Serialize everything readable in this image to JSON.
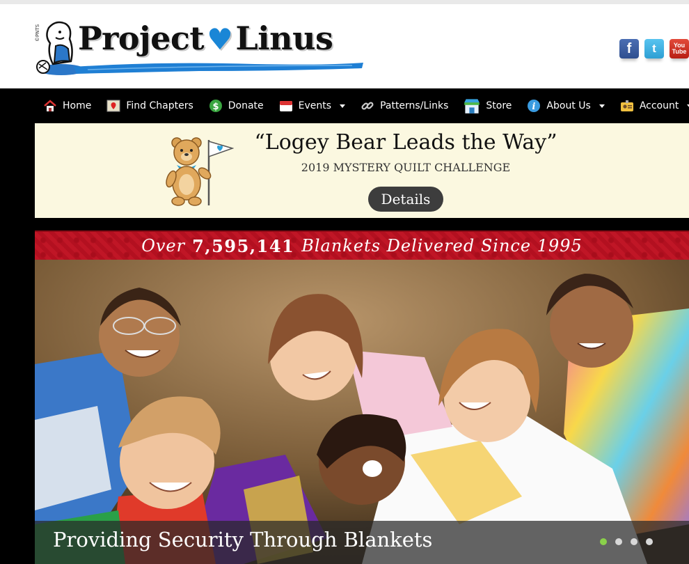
{
  "header": {
    "brand_left": "Project",
    "brand_heart": "♥",
    "brand_right": "Linus",
    "logo_tag": "©PNTS",
    "social": [
      {
        "name": "facebook",
        "glyph": "f"
      },
      {
        "name": "twitter",
        "glyph": "t"
      },
      {
        "name": "youtube",
        "glyph_top": "You",
        "glyph_bottom": "Tube"
      }
    ]
  },
  "nav": {
    "items": [
      {
        "label": "Home",
        "icon": "home-icon",
        "dropdown": false
      },
      {
        "label": "Find Chapters",
        "icon": "map-pin-icon",
        "dropdown": false
      },
      {
        "label": "Donate",
        "icon": "dollar-icon",
        "dropdown": false
      },
      {
        "label": "Events",
        "icon": "calendar-icon",
        "dropdown": true
      },
      {
        "label": "Patterns/Links",
        "icon": "link-icon",
        "dropdown": false
      },
      {
        "label": "Store",
        "icon": "store-icon",
        "dropdown": false
      },
      {
        "label": "About Us",
        "icon": "info-icon",
        "dropdown": true
      },
      {
        "label": "Account",
        "icon": "id-card-icon",
        "dropdown": true
      }
    ]
  },
  "banner": {
    "title": "“Logey Bear Leads the Way”",
    "subtitle": "2019 MYSTERY QUILT CHALLENGE",
    "button": "Details"
  },
  "counter": {
    "prefix": "Over",
    "number": "7,595,141",
    "suffix": "Blankets Delivered Since 1995"
  },
  "hero": {
    "caption": "Providing Security Through Blankets",
    "slides": 4,
    "active_slide": 1
  },
  "colors": {
    "heart": "#1a86d6",
    "counter_red": "#b31020",
    "active_dot": "#8ad04a",
    "banner_bg": "#fbf8e0"
  }
}
